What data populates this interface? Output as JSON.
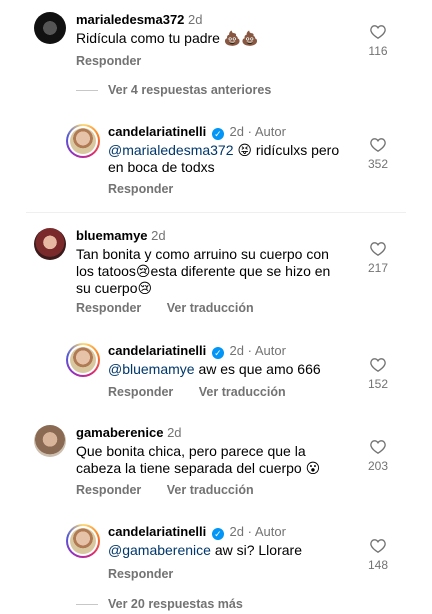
{
  "comments": [
    {
      "username": "marialedesma372",
      "time": "2d",
      "text": "Ridícula como tu padre 💩💩",
      "reply": "Responder",
      "likes": "116"
    },
    {
      "view_more": "Ver 4 respuestas anteriores"
    },
    {
      "username": "candelariatinelli",
      "time": "2d",
      "author": "Autor",
      "mention": "@marialedesma372",
      "text_a": "😝 ridículxs pero",
      "text_b": "en boca de todxs",
      "reply": "Responder",
      "likes": "352"
    },
    {
      "username": "bluemamye",
      "time": "2d",
      "line1": "Tan bonita y como arruino su cuerpo con",
      "line2": "los tatoos😢esta diferente que se hizo en",
      "line3": "su cuerpo😢",
      "reply": "Responder",
      "translate": "Ver traducción",
      "likes": "217"
    },
    {
      "username": "candelariatinelli",
      "time": "2d",
      "author": "Autor",
      "mention": "@bluemamye",
      "text": "aw es que amo 666",
      "reply": "Responder",
      "translate": "Ver traducción",
      "likes": "152"
    },
    {
      "username": "gamaberenice",
      "time": "2d",
      "line1": "Que bonita chica, pero parece que la",
      "line2": "cabeza la tiene separada del cuerpo 😮",
      "reply": "Responder",
      "translate": "Ver traducción",
      "likes": "203"
    },
    {
      "username": "candelariatinelli",
      "time": "2d",
      "author": "Autor",
      "mention": "@gamaberenice",
      "text": "aw si? Llorare",
      "reply": "Responder",
      "likes": "148"
    },
    {
      "view_more": "Ver 20 respuestas más"
    }
  ],
  "icons": {
    "like": "heart-outline-icon",
    "verified": "verified-badge-icon"
  },
  "colors": {
    "meta": "#737373",
    "mention": "#00376b",
    "verified": "#0095f6"
  }
}
